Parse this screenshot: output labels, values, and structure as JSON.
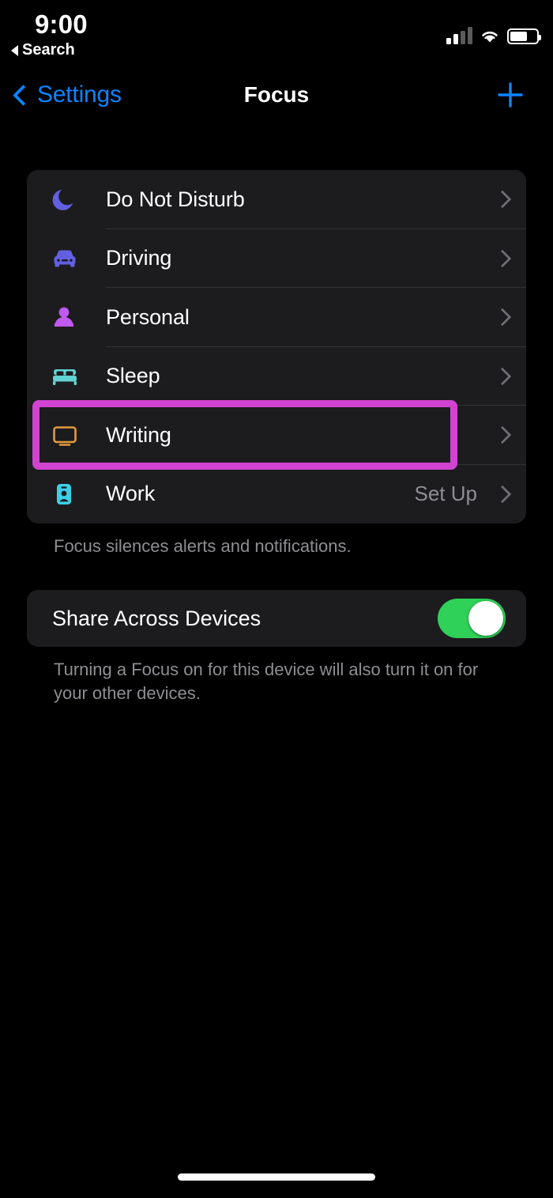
{
  "status_bar": {
    "time": "9:00",
    "back_label": "Search",
    "back_icon": "triangle-left-icon",
    "signal_icon": "cellular-signal-icon",
    "signal_bars_active": 2,
    "signal_bars_total": 4,
    "wifi_icon": "wifi-icon",
    "battery_icon": "battery-icon",
    "battery_level_percent": 58
  },
  "nav_bar": {
    "back_label": "Settings",
    "back_icon": "chevron-left-icon",
    "title": "Focus",
    "add_icon": "plus-icon"
  },
  "focus_list": {
    "rows": [
      {
        "label": "Do Not Disturb",
        "icon": "moon-icon",
        "icon_color": "#6260e0",
        "value": "",
        "chevron": "chevron-right-icon"
      },
      {
        "label": "Driving",
        "icon": "car-icon",
        "icon_color": "#6260e0",
        "value": "",
        "chevron": "chevron-right-icon"
      },
      {
        "label": "Personal",
        "icon": "person-icon",
        "icon_color": "#bf5af2",
        "value": "",
        "chevron": "chevron-right-icon"
      },
      {
        "label": "Sleep",
        "icon": "bed-icon",
        "icon_color": "#63d2d2",
        "value": "",
        "chevron": "chevron-right-icon"
      },
      {
        "label": "Writing",
        "icon": "display-icon",
        "icon_color": "#e09a3e",
        "value": "",
        "chevron": "chevron-right-icon"
      },
      {
        "label": "Work",
        "icon": "id-badge-icon",
        "icon_color": "#3ccfe8",
        "value": "Set Up",
        "chevron": "chevron-right-icon"
      }
    ],
    "footnote": "Focus silences alerts and notifications."
  },
  "share_section": {
    "label": "Share Across Devices",
    "toggle_on": true,
    "toggle_color": "#30d158",
    "footnote": "Turning a Focus on for this device will also turn it on for your other devices."
  },
  "highlight": {
    "target_label": "Writing",
    "color": "#d143d1"
  },
  "home_indicator": "home-indicator"
}
